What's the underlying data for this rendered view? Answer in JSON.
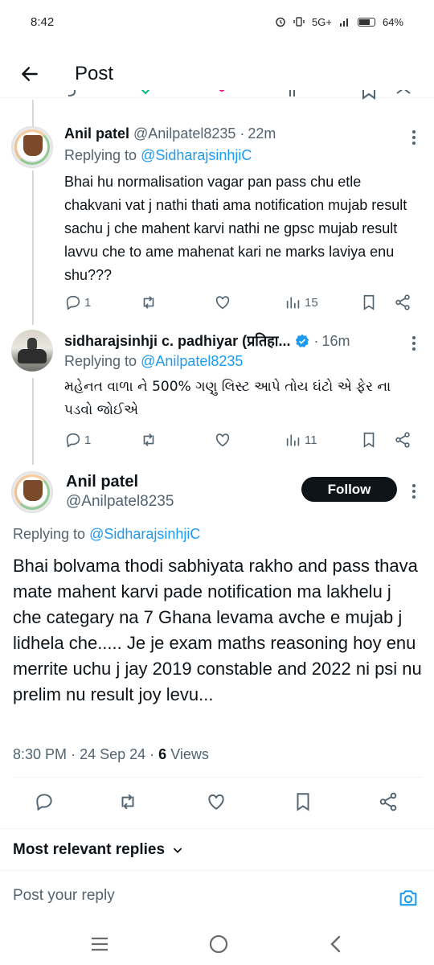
{
  "status_bar": {
    "time": "8:42",
    "network": "5G+",
    "battery": "64%"
  },
  "header": {
    "title": "Post"
  },
  "thread": [
    {
      "name": "Anil patel",
      "handle": "@Anilpatel8235",
      "time": "22m",
      "replying_prefix": "Replying to",
      "replying_to": "@SidharajsinhjiC",
      "text": "Bhai hu normalisation vagar pan pass chu etle chakvani vat j nathi thati ama notification mujab result sachu j che mahent karvi nathi ne gpsc mujab result lavvu che to ame mahenat kari ne marks laviya enu shu???",
      "replies": "1",
      "views": "15"
    },
    {
      "name": "sidharajsinhji c. padhiyar (प्रतिहा...",
      "handle": "",
      "time": "16m",
      "replying_prefix": "Replying to",
      "replying_to": "@Anilpatel8235",
      "text": "મહેનત વાળા ને 500% ગણુ લિસ્ટ આપે તોય ઘંટો એ ફેર ના પડવો જોઈએ",
      "replies": "1",
      "views": "11"
    }
  ],
  "main_post": {
    "name": "Anil patel",
    "handle": "@Anilpatel8235",
    "follow_label": "Follow",
    "replying_prefix": "Replying to",
    "replying_to": "@SidharajsinhjiC",
    "text": "Bhai bolvama thodi sabhiyata rakho and pass thava mate mahent karvi pade notification ma lakhelu j che categary na 7 Ghana levama avche e mujab j lidhela che..... Je je exam maths reasoning hoy enu merrite uchu j jay 2019 constable and 2022 ni psi nu prelim nu result joy levu...",
    "time": "8:30 PM",
    "date": "24 Sep 24",
    "views_count": "6",
    "views_label": "Views"
  },
  "sort": {
    "label": "Most relevant replies"
  },
  "reply_bar": {
    "placeholder": "Post your reply"
  },
  "colors": {
    "accent": "#1d9bf0",
    "text": "#0f1419",
    "muted": "#536471",
    "divider": "#eff3f4"
  },
  "icons": [
    "back-arrow-icon",
    "reply-icon",
    "repost-icon",
    "like-icon",
    "views-icon",
    "bookmark-icon",
    "share-icon",
    "more-icon",
    "verified-icon",
    "chevron-down-icon",
    "camera-icon",
    "menu-icon",
    "home-circle-icon",
    "back-nav-icon"
  ]
}
